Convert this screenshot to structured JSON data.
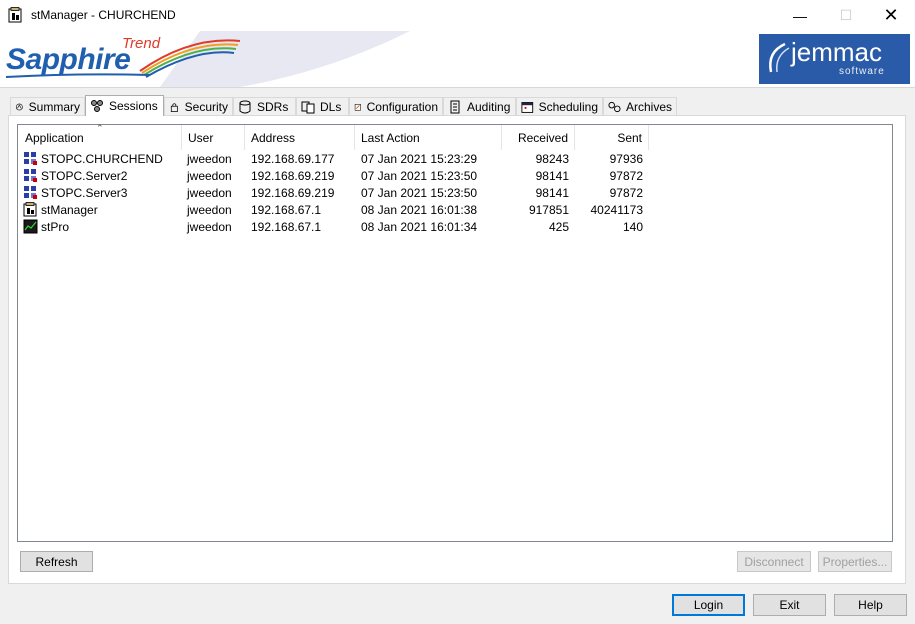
{
  "window": {
    "title": "stManager - CHURCHEND"
  },
  "banner": {
    "logo_main": "Sapphire",
    "logo_sub": "Trend",
    "vendor_name": "jemmac",
    "vendor_sub": "software"
  },
  "tabs": [
    {
      "label": "Summary",
      "icon": "summary-icon"
    },
    {
      "label": "Sessions",
      "icon": "sessions-icon",
      "active": true
    },
    {
      "label": "Security",
      "icon": "security-icon"
    },
    {
      "label": "SDRs",
      "icon": "database-icon"
    },
    {
      "label": "DLs",
      "icon": "dls-icon"
    },
    {
      "label": "Configuration",
      "icon": "configuration-icon"
    },
    {
      "label": "Auditing",
      "icon": "auditing-icon"
    },
    {
      "label": "Scheduling",
      "icon": "calendar-icon"
    },
    {
      "label": "Archives",
      "icon": "archives-icon"
    }
  ],
  "columns": {
    "application": "Application",
    "user": "User",
    "address": "Address",
    "last_action": "Last Action",
    "received": "Received",
    "sent": "Sent"
  },
  "rows": [
    {
      "application": "STOPC.CHURCHEND",
      "user": "jweedon",
      "address": "192.168.69.177",
      "last_action": "07 Jan 2021 15:23:29",
      "received": "98243",
      "sent": "97936",
      "icon": "opc-server-icon"
    },
    {
      "application": "STOPC.Server2",
      "user": "jweedon",
      "address": "192.168.69.219",
      "last_action": "07 Jan 2021 15:23:50",
      "received": "98141",
      "sent": "97872",
      "icon": "opc-server-icon"
    },
    {
      "application": "STOPC.Server3",
      "user": "jweedon",
      "address": "192.168.69.219",
      "last_action": "07 Jan 2021 15:23:50",
      "received": "98141",
      "sent": "97872",
      "icon": "opc-server-icon"
    },
    {
      "application": "stManager",
      "user": "jweedon",
      "address": "192.168.67.1",
      "last_action": "08 Jan 2021 16:01:38",
      "received": "917851",
      "sent": "40241173",
      "icon": "stmanager-icon"
    },
    {
      "application": "stPro",
      "user": "jweedon",
      "address": "192.168.67.1",
      "last_action": "08 Jan 2021 16:01:34",
      "received": "425",
      "sent": "140",
      "icon": "stpro-icon"
    }
  ],
  "buttons": {
    "refresh": "Refresh",
    "disconnect": "Disconnect",
    "properties": "Properties...",
    "login": "Login",
    "exit": "Exit",
    "help": "Help"
  },
  "colors": {
    "brand_blue": "#1f5fae",
    "vendor_blue": "#2a5ba8",
    "focus_blue": "#0078d7"
  }
}
